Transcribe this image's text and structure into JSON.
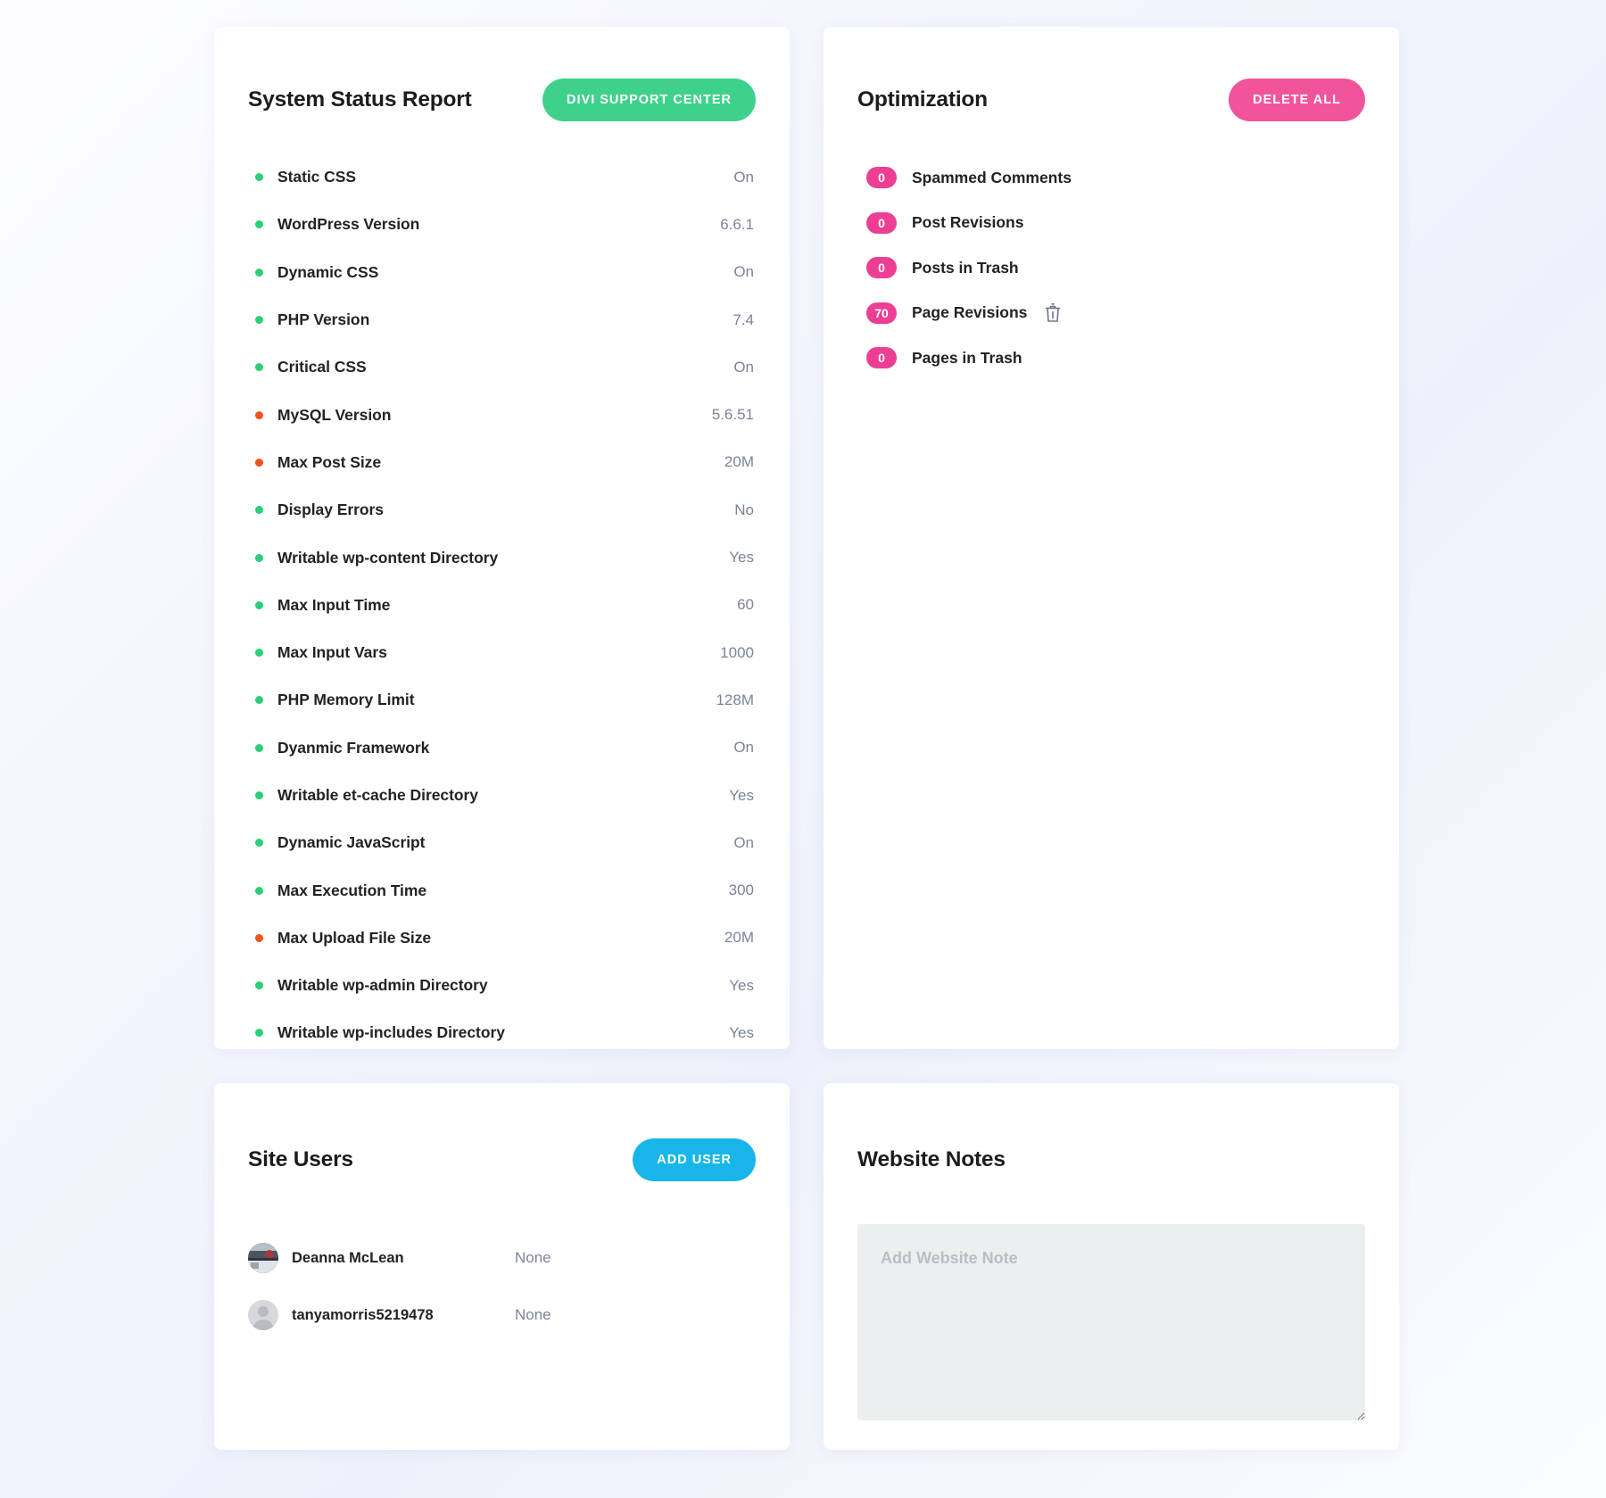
{
  "system_status": {
    "title": "System Status Report",
    "action_label": "DIVI SUPPORT CENTER",
    "accent": "#3ed18b",
    "rows": [
      {
        "label": "Static CSS",
        "value": "On",
        "state": "ok"
      },
      {
        "label": "WordPress Version",
        "value": "6.6.1",
        "state": "ok"
      },
      {
        "label": "Dynamic CSS",
        "value": "On",
        "state": "ok"
      },
      {
        "label": "PHP Version",
        "value": "7.4",
        "state": "ok"
      },
      {
        "label": "Critical CSS",
        "value": "On",
        "state": "ok"
      },
      {
        "label": "MySQL Version",
        "value": "5.6.51",
        "state": "warn"
      },
      {
        "label": "Max Post Size",
        "value": "20M",
        "state": "warn"
      },
      {
        "label": "Display Errors",
        "value": "No",
        "state": "ok"
      },
      {
        "label": "Writable wp-content Directory",
        "value": "Yes",
        "state": "ok"
      },
      {
        "label": "Max Input Time",
        "value": "60",
        "state": "ok"
      },
      {
        "label": "Max Input Vars",
        "value": "1000",
        "state": "ok"
      },
      {
        "label": "PHP Memory Limit",
        "value": "128M",
        "state": "ok"
      },
      {
        "label": "Dyanmic Framework",
        "value": "On",
        "state": "ok"
      },
      {
        "label": "Writable et-cache Directory",
        "value": "Yes",
        "state": "ok"
      },
      {
        "label": "Dynamic JavaScript",
        "value": "On",
        "state": "ok"
      },
      {
        "label": "Max Execution Time",
        "value": "300",
        "state": "ok"
      },
      {
        "label": "Max Upload File Size",
        "value": "20M",
        "state": "warn"
      },
      {
        "label": "Writable wp-admin Directory",
        "value": "Yes",
        "state": "ok"
      },
      {
        "label": "Writable wp-includes Directory",
        "value": "Yes",
        "state": "ok"
      }
    ]
  },
  "optimization": {
    "title": "Optimization",
    "action_label": "DELETE ALL",
    "accent": "#f2549c",
    "badge_color": "#ec3f94",
    "rows": [
      {
        "count": "0",
        "label": "Spammed Comments",
        "has_delete": false
      },
      {
        "count": "0",
        "label": "Post Revisions",
        "has_delete": false
      },
      {
        "count": "0",
        "label": "Posts in Trash",
        "has_delete": false
      },
      {
        "count": "70",
        "label": "Page Revisions",
        "has_delete": true
      },
      {
        "count": "0",
        "label": "Pages in Trash",
        "has_delete": false
      }
    ]
  },
  "site_users": {
    "title": "Site Users",
    "action_label": "ADD USER",
    "accent": "#18b6e8",
    "rows": [
      {
        "name": "Deanna McLean",
        "role": "None",
        "avatar": "photo-avatar"
      },
      {
        "name": "tanyamorris5219478",
        "role": "None",
        "avatar": "default-avatar"
      }
    ]
  },
  "website_notes": {
    "title": "Website Notes",
    "note_value": "",
    "note_placeholder": "Add Website Note"
  },
  "icons": {
    "trash": "trash-icon",
    "resize_handle": "resize-handle-icon"
  }
}
